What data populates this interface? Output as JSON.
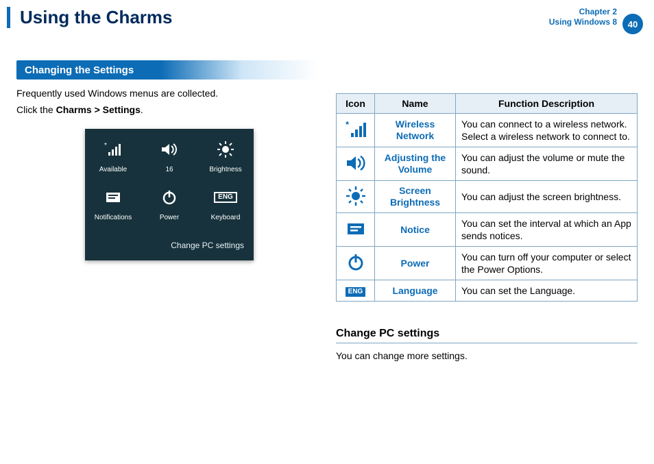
{
  "header": {
    "title": "Using the Charms",
    "chapter_line1": "Chapter 2",
    "chapter_line2": "Using Windows 8",
    "page": "40"
  },
  "section": {
    "title": "Changing the Settings"
  },
  "left": {
    "p1": "Frequently used Windows menus are collected.",
    "p2_prefix": "Click the ",
    "p2_bold": "Charms > Settings",
    "p2_suffix": "."
  },
  "panel": {
    "items": [
      {
        "label": "Available",
        "icon": "wireless-icon"
      },
      {
        "label": "16",
        "icon": "volume-icon"
      },
      {
        "label": "Brightness",
        "icon": "brightness-icon"
      },
      {
        "label": "Notifications",
        "icon": "notice-icon"
      },
      {
        "label": "Power",
        "icon": "power-icon"
      },
      {
        "label": "Keyboard",
        "icon": "keyboard-icon"
      }
    ],
    "link": "Change PC settings"
  },
  "table": {
    "headers": {
      "icon": "Icon",
      "name": "Name",
      "desc": "Function Description"
    },
    "rows": [
      {
        "icon": "wireless-icon",
        "name": "Wireless Network",
        "desc": "You can connect to a wireless network. Select a wireless network to connect to."
      },
      {
        "icon": "volume-icon",
        "name": "Adjusting the Volume",
        "desc": "You can adjust the volume or mute the sound."
      },
      {
        "icon": "brightness-icon",
        "name": "Screen Brightness",
        "desc": "You can adjust the screen brightness."
      },
      {
        "icon": "notice-icon",
        "name": "Notice",
        "desc": "You can set the interval at which an App sends notices."
      },
      {
        "icon": "power-icon",
        "name": "Power",
        "desc": "You can turn off your computer or select the Power Options."
      },
      {
        "icon": "keyboard-icon",
        "name": "Language",
        "desc": "You can set the Language."
      }
    ]
  },
  "sub": {
    "heading": "Change PC settings",
    "body": "You can change more settings."
  },
  "glyphs": {
    "eng": "ENG"
  }
}
